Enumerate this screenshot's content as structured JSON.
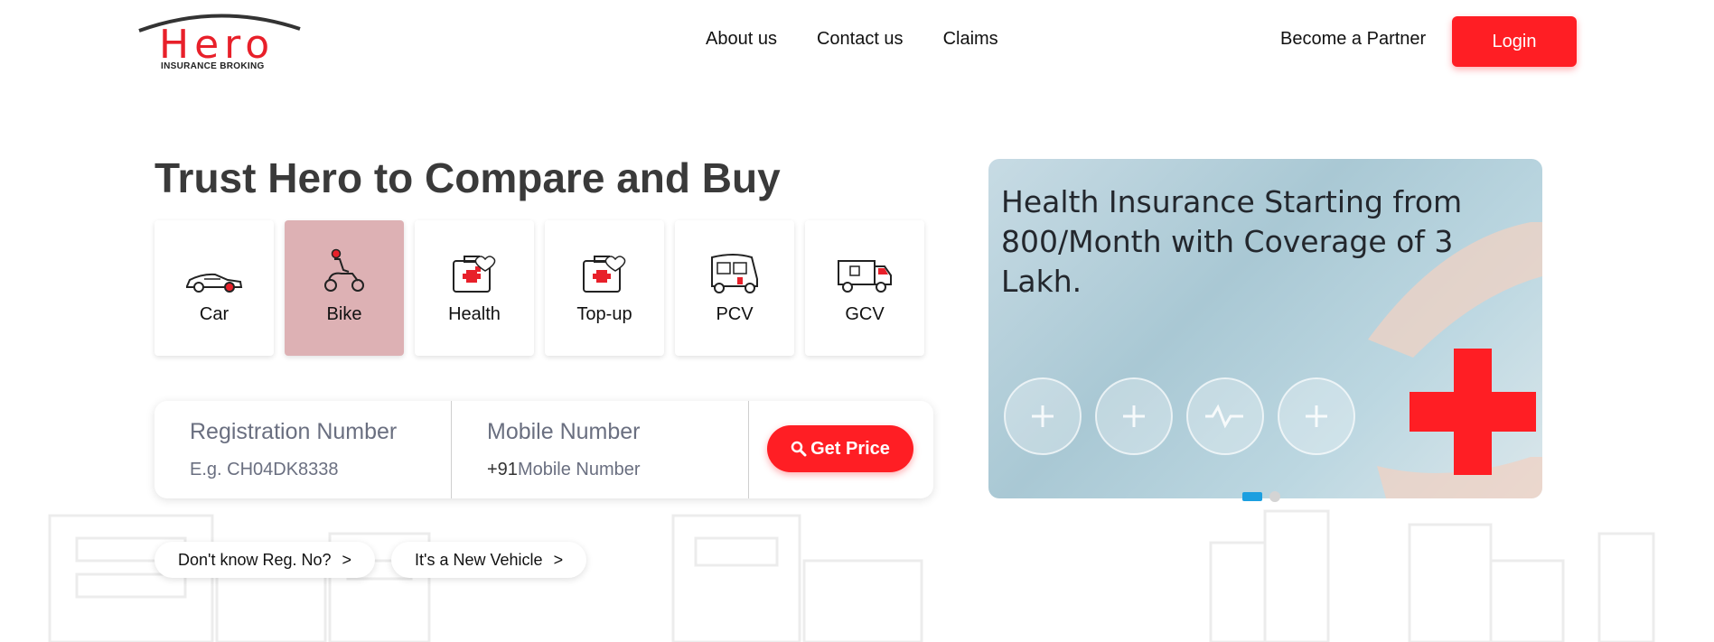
{
  "brand": {
    "name": "Hero",
    "tagline": "INSURANCE BROKING",
    "primary_color": "#ff1e24"
  },
  "nav": {
    "items": [
      "About us",
      "Contact us",
      "Claims"
    ],
    "partner_label": "Become a Partner",
    "login_label": "Login"
  },
  "hero": {
    "title": "Trust Hero to Compare and Buy",
    "products": [
      {
        "label": "Car",
        "icon": "car-icon",
        "active": false
      },
      {
        "label": "Bike",
        "icon": "bike-icon",
        "active": true
      },
      {
        "label": "Health",
        "icon": "health-kit-icon",
        "active": false
      },
      {
        "label": "Top-up",
        "icon": "health-topup-icon",
        "active": false
      },
      {
        "label": "PCV",
        "icon": "auto-rickshaw-icon",
        "active": false
      },
      {
        "label": "GCV",
        "icon": "goods-truck-icon",
        "active": false
      }
    ]
  },
  "form": {
    "registration": {
      "label": "Registration Number",
      "placeholder": "E.g. CH04DK8338"
    },
    "mobile": {
      "label": "Mobile Number",
      "prefix": "+91",
      "placeholder": "Mobile Number"
    },
    "submit_label": "Get Price"
  },
  "links": {
    "dont_know": "Don't know Reg. No?",
    "new_vehicle": "It's a New Vehicle",
    "chevron": ">"
  },
  "banner": {
    "text": "Health Insurance Starting from 800/Month with Coverage of 3 Lakh.",
    "slide_count": 2,
    "active_slide": 1
  }
}
